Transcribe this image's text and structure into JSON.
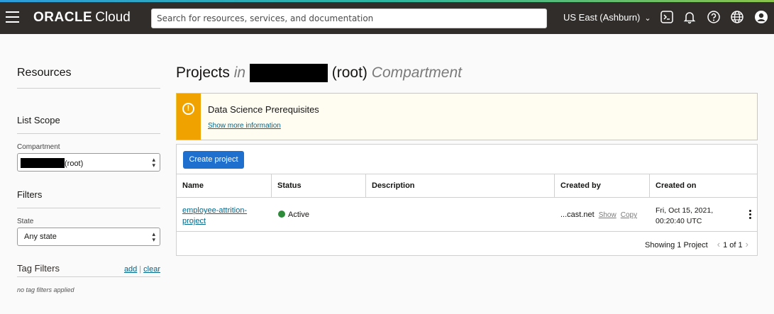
{
  "header": {
    "logo_brand": "ORACLE",
    "logo_product": "Cloud",
    "search_placeholder": "Search for resources, services, and documentation",
    "region": "US East (Ashburn)",
    "icons": [
      "menu-icon",
      "cloud-shell-icon",
      "bell-icon",
      "help-icon",
      "globe-icon",
      "profile-icon"
    ]
  },
  "sidebar": {
    "title": "Resources",
    "list_scope": "List Scope",
    "compartment_label": "Compartment",
    "compartment_value": "(root)",
    "filters_title": "Filters",
    "state_label": "State",
    "state_value": "Any state",
    "tag_filters_title": "Tag Filters",
    "tag_add": "add",
    "tag_clear": "clear",
    "no_tags": "no tag filters applied"
  },
  "page": {
    "title_prefix": "Projects",
    "title_in": "in",
    "title_root": "(root)",
    "title_suffix": "Compartment"
  },
  "banner": {
    "title": "Data Science Prerequisites",
    "link": "Show more information",
    "color": "#f0a200"
  },
  "table": {
    "create_button": "Create project",
    "columns": [
      "Name",
      "Status",
      "Description",
      "Created by",
      "Created on"
    ],
    "rows": [
      {
        "name_line1": "employee-attrition-",
        "name_line2": "project",
        "status": "Active",
        "description": "",
        "created_by": "...cast.net",
        "show": "Show",
        "copy": "Copy",
        "created_on_line1": "Fri, Oct 15, 2021,",
        "created_on_line2": "00:20:40 UTC"
      }
    ],
    "footer_showing": "Showing 1 Project",
    "footer_pages": "1 of 1"
  }
}
